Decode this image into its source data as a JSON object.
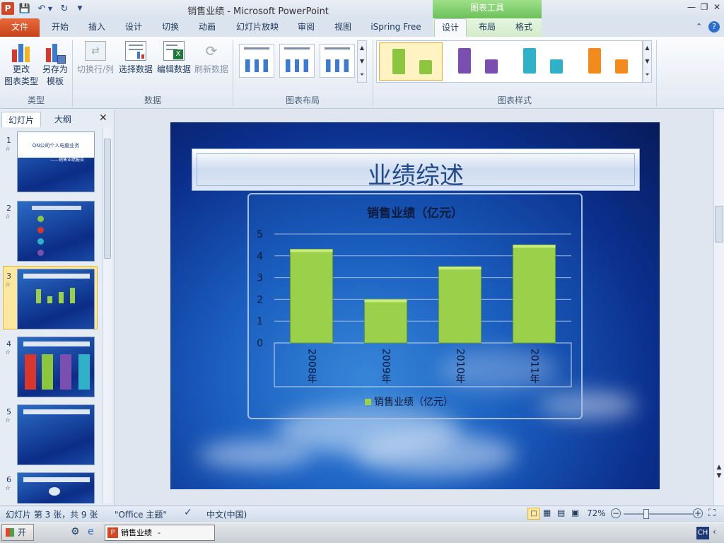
{
  "title_bar": {
    "title": "销售业绩 - Microsoft PowerPoint",
    "context_tools": "图表工具",
    "qat": [
      "save-icon",
      "undo-icon",
      "redo-icon",
      "customize-qat-icon"
    ]
  },
  "tabs": [
    {
      "label": "文件"
    },
    {
      "label": "开始"
    },
    {
      "label": "插入"
    },
    {
      "label": "设计"
    },
    {
      "label": "切换"
    },
    {
      "label": "动画"
    },
    {
      "label": "幻灯片放映"
    },
    {
      "label": "审阅"
    },
    {
      "label": "视图"
    },
    {
      "label": "iSpring Free"
    },
    {
      "label": "设计"
    },
    {
      "label": "布局"
    },
    {
      "label": "格式"
    }
  ],
  "ribbon": {
    "groups": {
      "type": "类型",
      "data": "数据",
      "layout": "图表布局",
      "styles": "图表样式"
    },
    "buttons": {
      "change_type_1": "更改",
      "change_type_2": "图表类型",
      "save_template_1": "另存为",
      "save_template_2": "模板",
      "switch_rowcol": "切换行/列",
      "select_data": "选择数据",
      "edit_data": "编辑数据",
      "refresh_data": "刷新数据"
    },
    "style_colors": [
      "#8cc63f",
      "#7a4fb0",
      "#2fb2c8",
      "#f28a1e"
    ]
  },
  "left_pane": {
    "tabs": [
      "幻灯片",
      "大纲"
    ],
    "slides": [
      {
        "num": "1",
        "t1": "QN公司个人电脑业务",
        "t2": "——销售业绩报告"
      },
      {
        "num": "2"
      },
      {
        "num": "3"
      },
      {
        "num": "4"
      },
      {
        "num": "5"
      },
      {
        "num": "6"
      }
    ]
  },
  "slide": {
    "title": "业绩综述"
  },
  "chart_data": {
    "type": "bar",
    "title": "销售业绩（亿元）",
    "categories": [
      "2008年",
      "2009年",
      "2010年",
      "2011年"
    ],
    "series": [
      {
        "name": "销售业绩（亿元）",
        "values": [
          4.3,
          2.0,
          3.5,
          4.5
        ]
      }
    ],
    "ylim": [
      0,
      5
    ],
    "yticks": [
      "0",
      "1",
      "2",
      "3",
      "4",
      "5"
    ],
    "color": "#9bd14a",
    "grid": true,
    "legend": "bottom"
  },
  "status_bar": {
    "slide_info": "幻灯片 第 3 张，共 9 张",
    "theme": "\"Office 主题\"",
    "language": "中文(中国)",
    "zoom": "72%"
  },
  "taskbar": {
    "start": "开始",
    "task": "销售业绩 - Microsof...",
    "ime": "CH"
  }
}
